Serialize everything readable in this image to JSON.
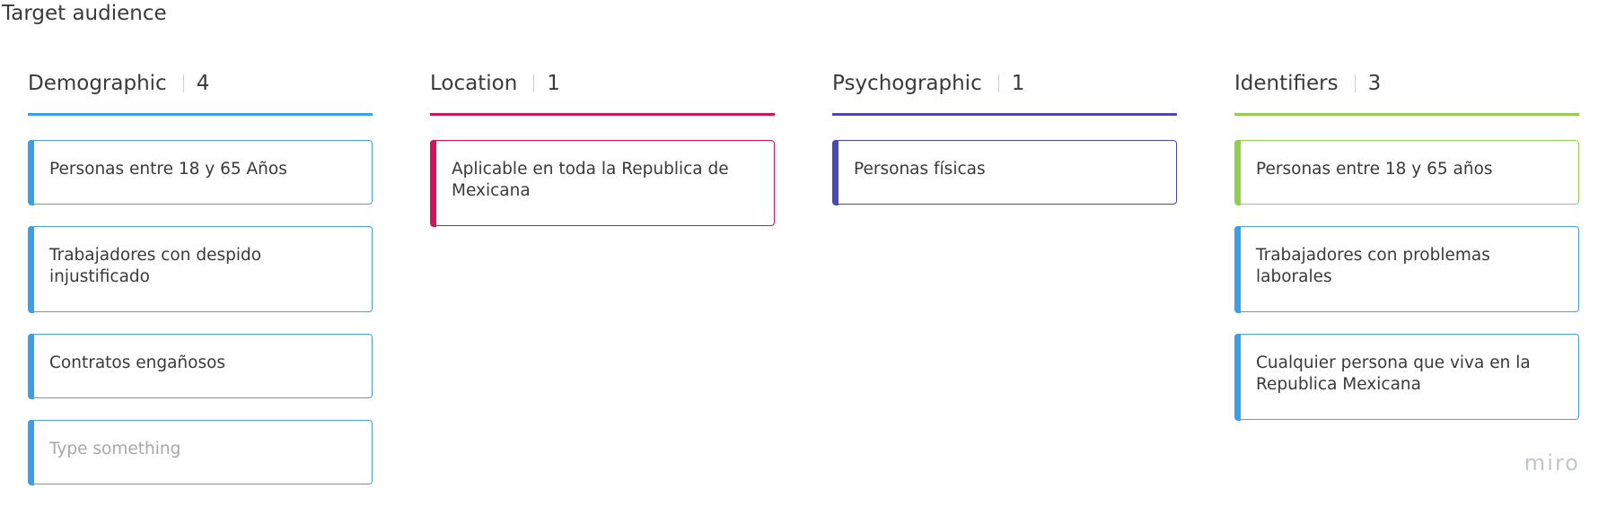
{
  "board": {
    "title": "Target audience"
  },
  "columns": [
    {
      "name": "Demographic",
      "count": "4",
      "color": "#3b9ee8",
      "cards": [
        {
          "text": "Personas entre 18 y 65 Años",
          "accent": "#3b9ee8",
          "border": "#4a9fd8"
        },
        {
          "text": "Trabajadores con despido injustificado",
          "accent": "#3b9ee8",
          "border": "#4a9fd8"
        },
        {
          "text": "Contratos engañosos",
          "accent": "#3b9ee8",
          "border": "#4a9fd8"
        },
        {
          "text": "",
          "placeholder": "Type something",
          "accent": "#3b9ee8",
          "border": "#4a9fd8"
        }
      ]
    },
    {
      "name": "Location",
      "count": "1",
      "color": "#d4145a",
      "cards": [
        {
          "text": "Aplicable en toda la Republica de Mexicana",
          "accent": "#d4145a",
          "border": "#d4145a"
        }
      ]
    },
    {
      "name": "Psychographic",
      "count": "1",
      "color": "#4a4ab5",
      "cards": [
        {
          "text": "Personas físicas",
          "accent": "#4a4ab5",
          "border": "#4a4ab5"
        }
      ]
    },
    {
      "name": "Identifiers",
      "count": "3",
      "color": "#8fd14f",
      "cards": [
        {
          "text": "Personas entre 18 y 65 años",
          "accent": "#8fd14f",
          "border": "#8fd14f"
        },
        {
          "text": "Trabajadores con problemas laborales",
          "accent": "#3b9ee8",
          "border": "#4a9fd8"
        },
        {
          "text": "Cualquier persona que viva en la Republica Mexicana",
          "accent": "#3b9ee8",
          "border": "#4a9fd8"
        }
      ]
    }
  ],
  "branding": {
    "logo_text": "miro"
  }
}
